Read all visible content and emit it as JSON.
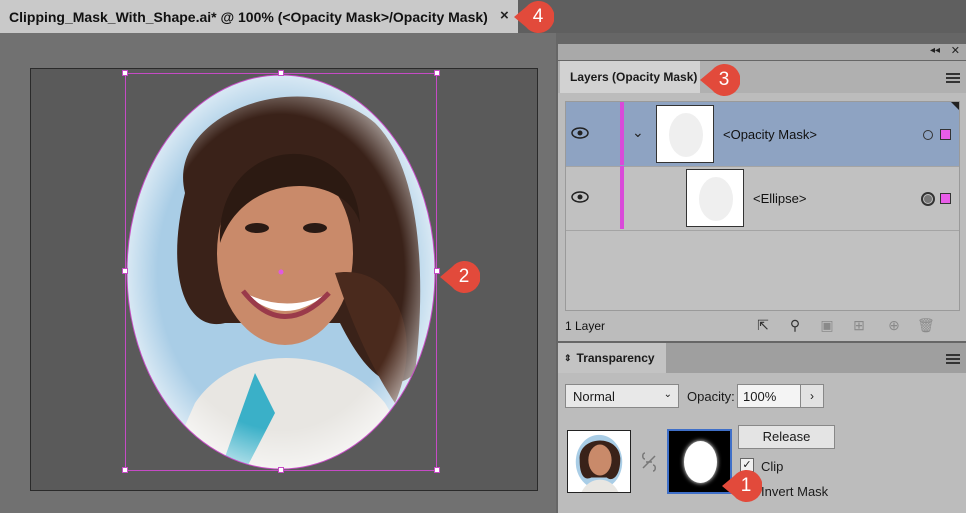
{
  "document": {
    "tab_title": "Clipping_Mask_With_Shape.ai* @ 100% (<Opacity Mask>/Opacity Mask)",
    "close_glyph": "×"
  },
  "callouts": [
    "1",
    "2",
    "3",
    "4"
  ],
  "layers_panel": {
    "tab_label": "Layers (Opacity Mask)",
    "rows": [
      {
        "label": "<Opacity Mask>",
        "selected": true,
        "expanded": true
      },
      {
        "label": "<Ellipse>",
        "selected": false,
        "expanded": false
      }
    ],
    "footer_label": "1 Layer",
    "layer_color": "#d94ad9",
    "selection_color": "#8ea3c2"
  },
  "transparency_panel": {
    "tab_label": "Transparency",
    "blend_mode": "Normal",
    "opacity_label": "Opacity:",
    "opacity_value": "100%",
    "release_label": "Release",
    "clip_label": "Clip",
    "clip_checked": true,
    "invert_label": "Invert Mask",
    "invert_checked": false
  },
  "colors": {
    "callout_red": "#e24a3b",
    "selection_magenta": "#c64bc6"
  }
}
